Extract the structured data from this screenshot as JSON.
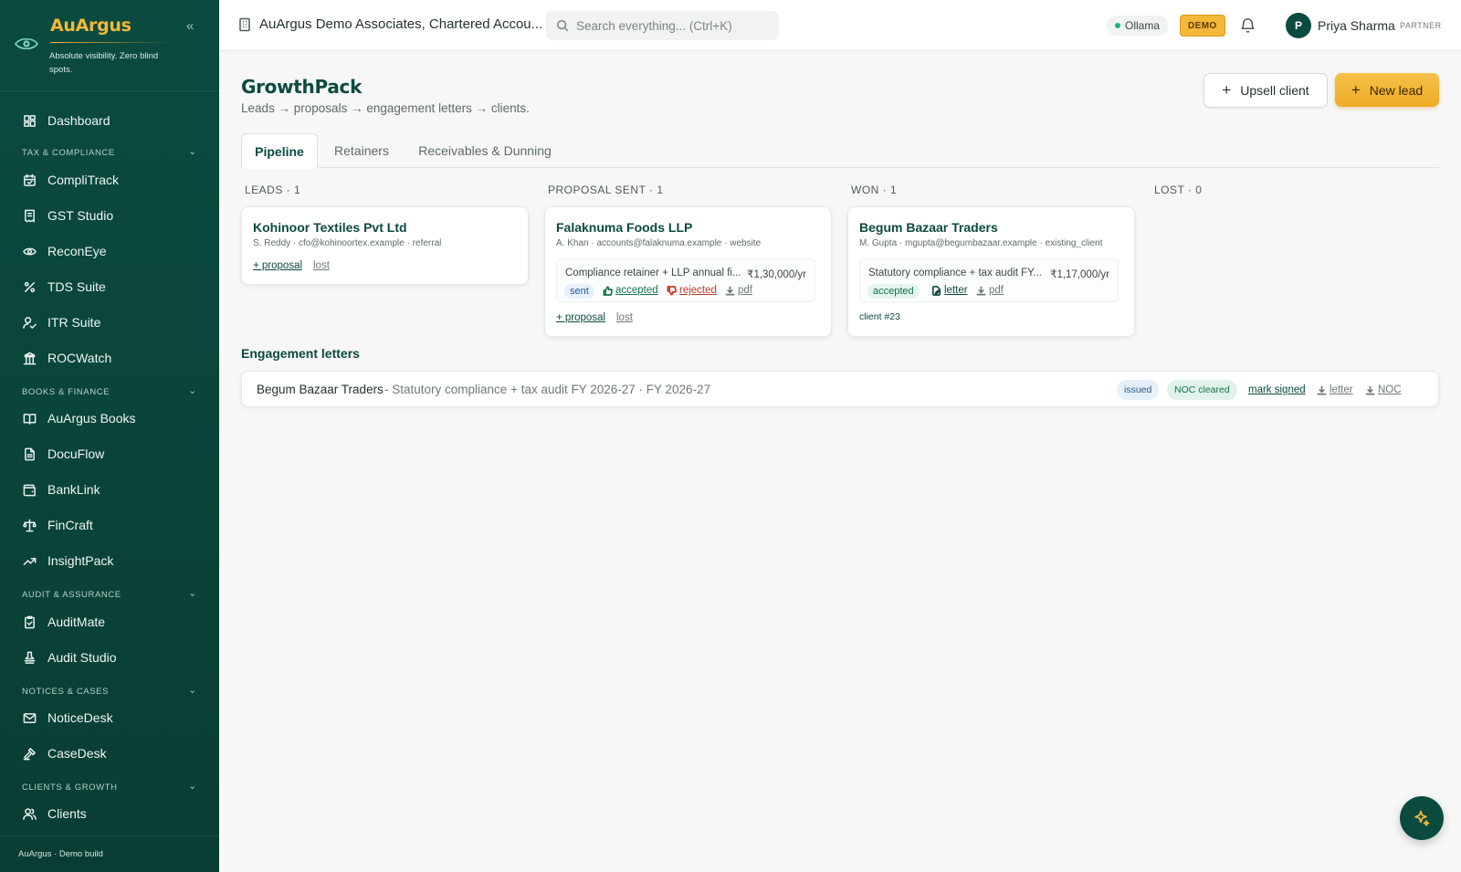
{
  "brand": {
    "name": "AuArgus",
    "tagline": "Absolute visibility. Zero blind spots.",
    "collapse_icon": "«"
  },
  "sidebar": {
    "items": [
      {
        "label": "Dashboard",
        "icon": "dashboard-icon"
      },
      {
        "section": "TAX & COMPLIANCE"
      },
      {
        "label": "CompliTrack",
        "icon": "calendar-check-icon"
      },
      {
        "label": "GST Studio",
        "icon": "receipt-icon"
      },
      {
        "label": "ReconEye",
        "icon": "eye-icon"
      },
      {
        "label": "TDS Suite",
        "icon": "percent-icon"
      },
      {
        "label": "ITR Suite",
        "icon": "user-check-icon"
      },
      {
        "label": "ROCWatch",
        "icon": "building-icon"
      },
      {
        "section": "BOOKS & FINANCE"
      },
      {
        "label": "AuArgus Books",
        "icon": "book-open-icon"
      },
      {
        "label": "DocuFlow",
        "icon": "file-text-icon"
      },
      {
        "label": "BankLink",
        "icon": "wallet-icon"
      },
      {
        "label": "FinCraft",
        "icon": "scale-icon"
      },
      {
        "label": "InsightPack",
        "icon": "trending-up-icon"
      },
      {
        "section": "AUDIT & ASSURANCE"
      },
      {
        "label": "AuditMate",
        "icon": "clipboard-check-icon"
      },
      {
        "label": "Audit Studio",
        "icon": "stamp-icon"
      },
      {
        "section": "NOTICES & CASES"
      },
      {
        "label": "NoticeDesk",
        "icon": "mail-icon"
      },
      {
        "label": "CaseDesk",
        "icon": "gavel-icon"
      },
      {
        "section": "CLIENTS & GROWTH"
      },
      {
        "label": "Clients",
        "icon": "users-icon"
      }
    ],
    "footer": "AuArgus · Demo build"
  },
  "topbar": {
    "org": "AuArgus Demo Associates, Chartered Accou...",
    "search_placeholder": "Search everything... (Ctrl+K)",
    "ollama": "Ollama",
    "demo": "DEMO",
    "user": {
      "initial": "P",
      "name": "Priya Sharma",
      "role": "PARTNER"
    }
  },
  "page": {
    "title": "GrowthPack",
    "subtitle": "Leads → proposals → engagement letters → clients.",
    "upsell_label": "Upsell client",
    "new_lead_label": "New lead",
    "tabs": [
      "Pipeline",
      "Retainers",
      "Receivables & Dunning"
    ]
  },
  "pipeline": {
    "columns": [
      "LEADS · 1",
      "PROPOSAL SENT · 1",
      "WON · 1",
      "LOST · 0"
    ],
    "leads": [
      {
        "name": "Kohinoor Textiles Pvt Ltd",
        "meta": "S. Reddy · cfo@kohinoortex.example · referral",
        "proposal_link": "+ proposal",
        "lost_link": "lost"
      }
    ],
    "proposal_sent": [
      {
        "name": "Falaknuma Foods LLP",
        "meta": "A. Khan · accounts@falaknuma.example · website",
        "proposal": {
          "desc": "Compliance retainer + LLP annual fi...",
          "amount": "₹1,30,000/yr",
          "status": "sent",
          "accepted": "accepted",
          "rejected": "rejected",
          "pdf": "pdf"
        },
        "proposal_link": "+ proposal",
        "lost_link": "lost"
      }
    ],
    "won": [
      {
        "name": "Begum Bazaar Traders",
        "meta": "M. Gupta · mgupta@begumbazaar.example · existing_client",
        "proposal": {
          "desc": "Statutory compliance + tax audit FY...",
          "amount": "₹1,17,000/yr",
          "status": "accepted",
          "letter": "letter",
          "pdf": "pdf"
        },
        "client_link": "client #23"
      }
    ]
  },
  "engagement": {
    "title": "Engagement letters",
    "rows": [
      {
        "client": "Begum Bazaar Traders",
        "desc": "- Statutory compliance + tax audit FY 2026-27 · FY 2026-27",
        "status": "issued",
        "noc": "NOC cleared",
        "mark_signed": "mark signed",
        "letter": "letter",
        "noc_link": "NOC"
      }
    ]
  },
  "colors": {
    "brand": "#0b4a3f",
    "accent": "#f3b739"
  }
}
